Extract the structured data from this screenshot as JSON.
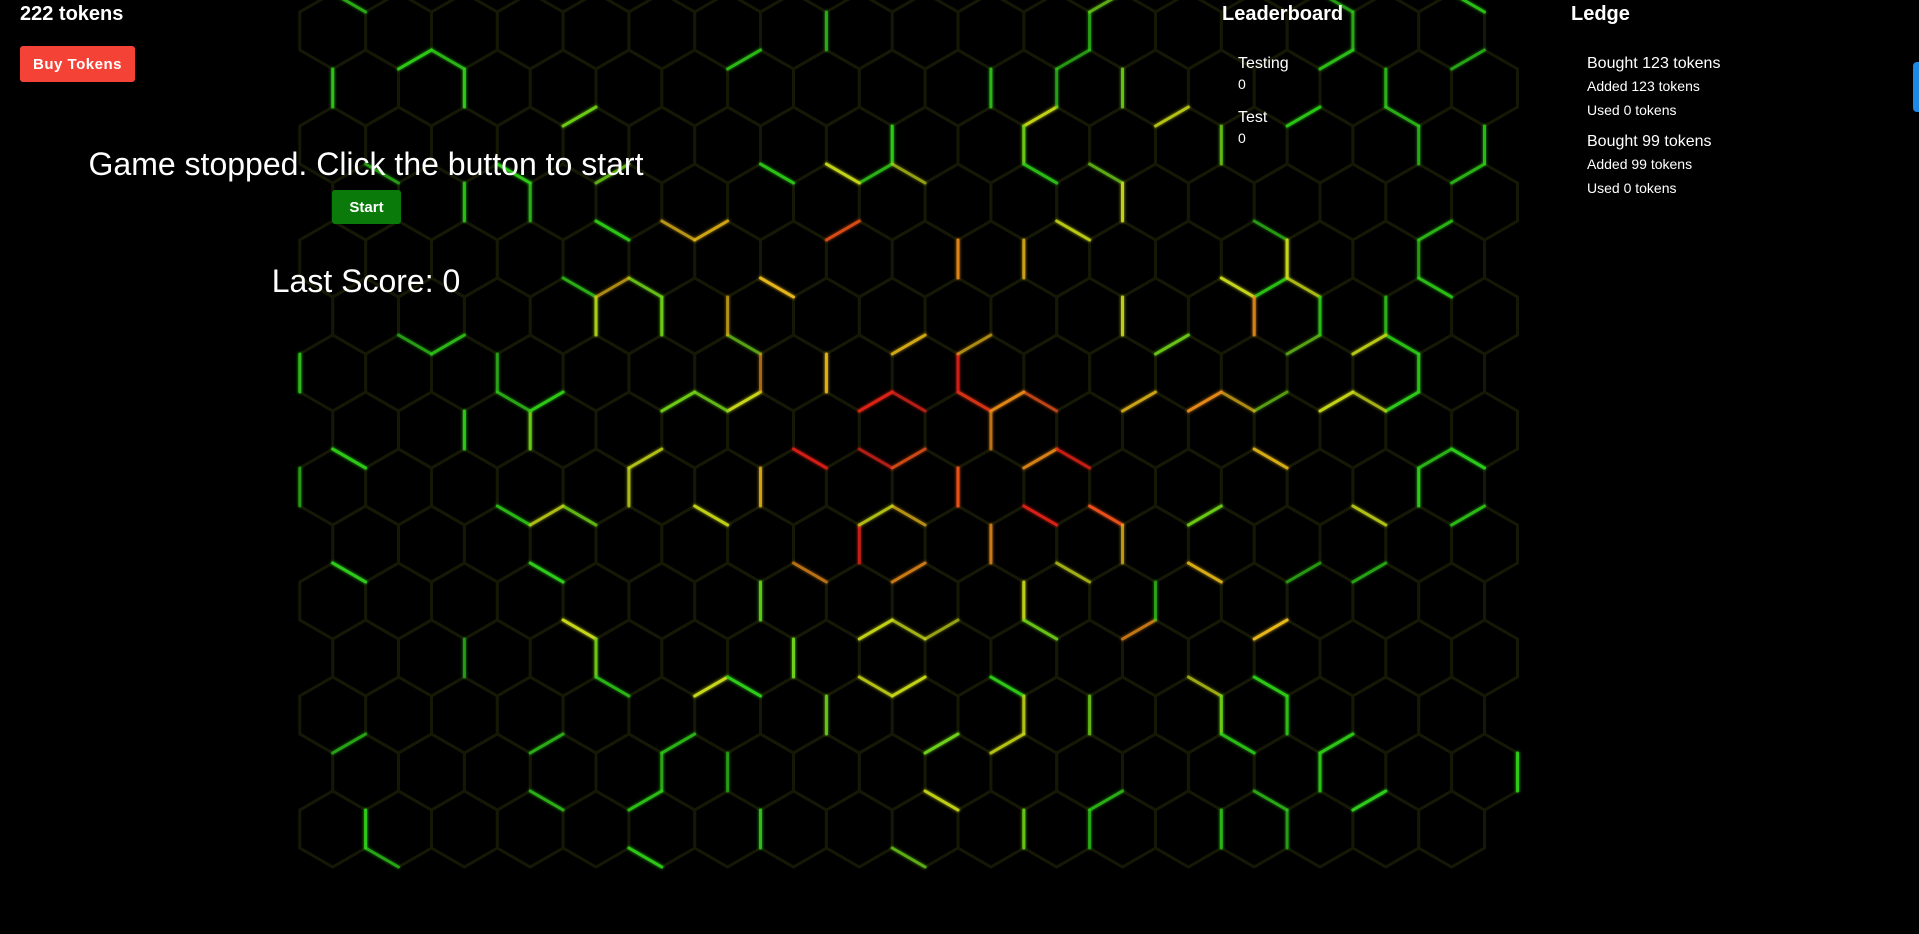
{
  "tokens": {
    "count_label": "222 tokens"
  },
  "buy_button": {
    "label": "Buy Tokens"
  },
  "game": {
    "status_message": "Game stopped. Click the button to start",
    "start_label": "Start",
    "last_score_label": "Last Score: 0"
  },
  "leaderboard": {
    "heading": "Leaderboard",
    "entries": [
      {
        "name": "Testing",
        "score": "0"
      },
      {
        "name": "Test",
        "score": "0"
      }
    ]
  },
  "ledger": {
    "heading": "Ledge",
    "entries": [
      {
        "title": "Bought 123 tokens",
        "added": "Added 123 tokens",
        "used": "Used 0 tokens"
      },
      {
        "title": "Bought 99 tokens",
        "added": "Added 99 tokens",
        "used": "Used 0 tokens"
      }
    ]
  },
  "colors": {
    "background": "#000000",
    "buy_button": "#f44336",
    "start_button": "#0a7a0a",
    "grid": "#151805",
    "side_tab": "#1e88e5"
  }
}
